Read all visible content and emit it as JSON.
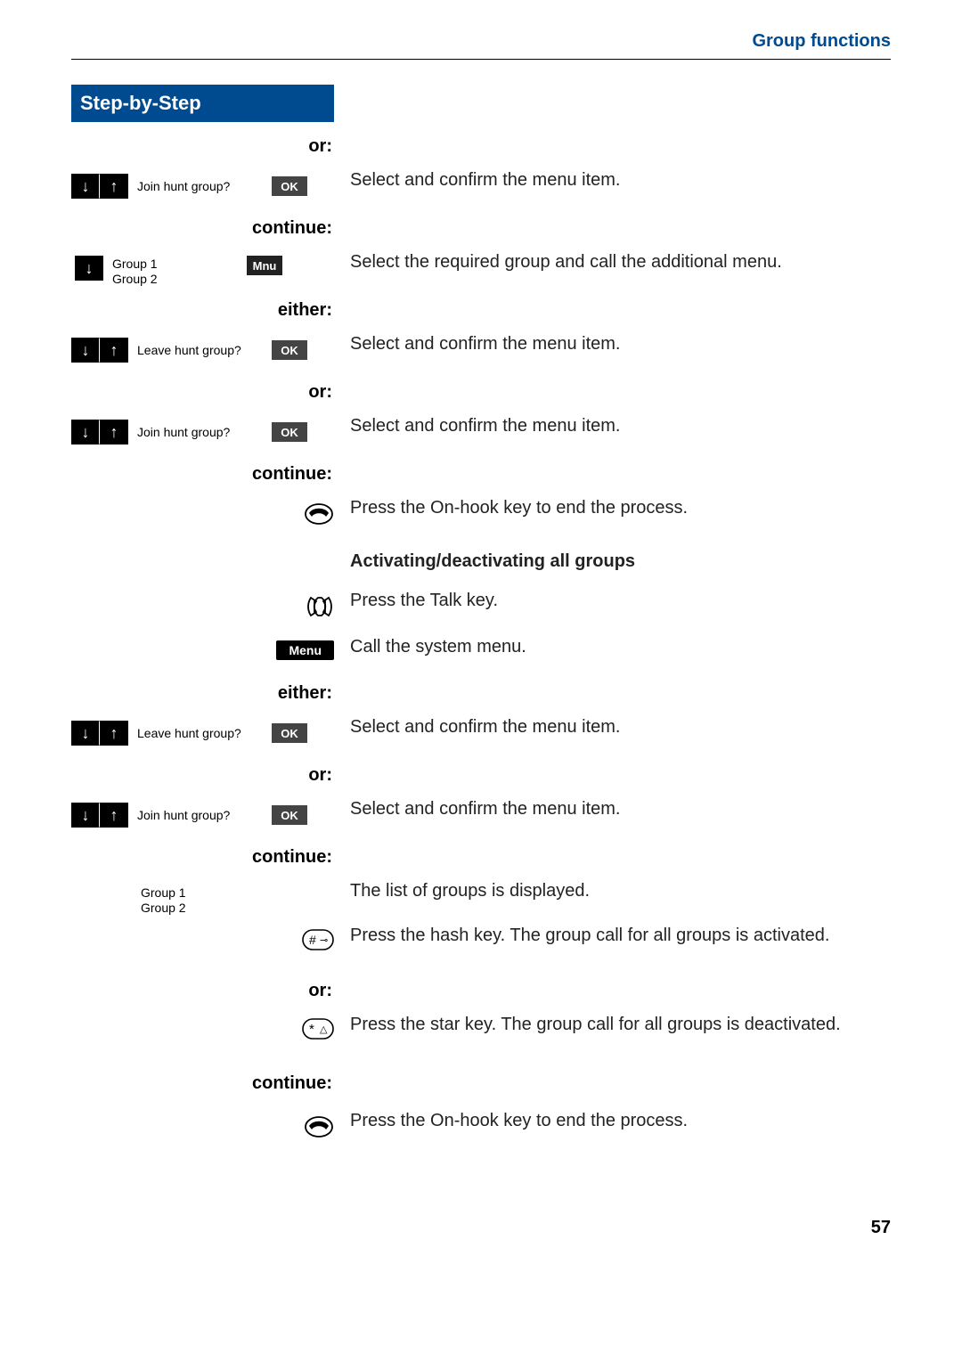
{
  "header": {
    "title": "Group functions"
  },
  "left": {
    "step_header": "Step-by-Step",
    "labels": {
      "or": "or:",
      "continue": "continue:",
      "either": "either:"
    },
    "buttons": {
      "ok": "OK",
      "mnu": "Mnu",
      "menu": "Menu"
    },
    "menu_items": {
      "join": "Join hunt group?",
      "leave": "Leave hunt group?",
      "group1": "Group 1",
      "group2": "Group 2"
    }
  },
  "right": {
    "r1": "Select and confirm the menu item.",
    "r2": "Select the required group and call the additional menu.",
    "r3": "Select and confirm the menu item.",
    "r4": "Select and confirm the menu item.",
    "r5": "Press the On-hook key to end the process.",
    "heading1": "Activating/deactivating all groups",
    "r6": "Press the Talk key.",
    "r7": "Call the system menu.",
    "r8": "Select and confirm the menu item.",
    "r9": "Select and confirm the menu item.",
    "r10": "The list of groups is displayed.",
    "r11": "Press the hash key. The group call for all groups is activated.",
    "r12": "Press the star key. The group call for all groups is deactivated.",
    "r13": "Press the On-hook key to end the process."
  },
  "page_number": "57"
}
